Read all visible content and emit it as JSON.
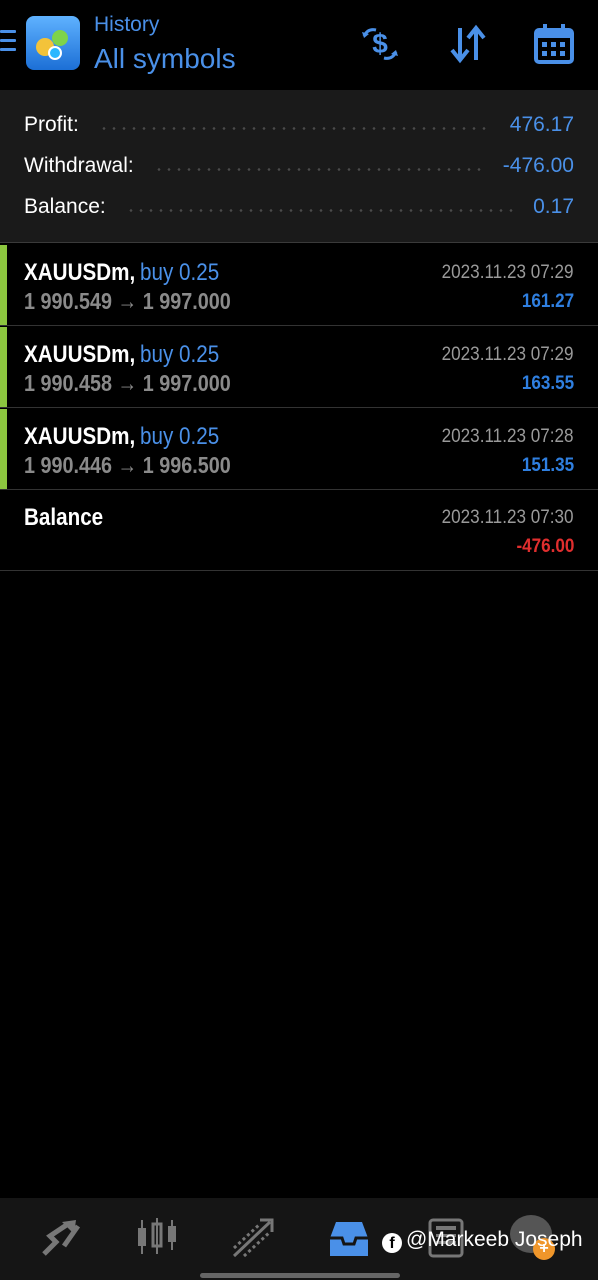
{
  "header": {
    "title_small": "History",
    "title_big": "All symbols",
    "icons": [
      "menu-icon",
      "app-logo",
      "deposit-withdrawal-icon",
      "sort-icon",
      "calendar-icon"
    ],
    "accent_color": "#4a90e8"
  },
  "summary": {
    "profit_label": "Profit:",
    "profit_value": "476.17",
    "withdrawal_label": "Withdrawal:",
    "withdrawal_value": "-476.00",
    "balance_label": "Balance:",
    "balance_value": "0.17"
  },
  "trades": [
    {
      "symbol": "XAUUSDm,",
      "type": "buy 0.25",
      "prices": "1 990.549 → 1 997.000",
      "time": "2023.11.23 07:29",
      "profit": "161.27"
    },
    {
      "symbol": "XAUUSDm,",
      "type": "buy 0.25",
      "prices": "1 990.458 → 1 997.000",
      "time": "2023.11.23 07:29",
      "profit": "163.55"
    },
    {
      "symbol": "XAUUSDm,",
      "type": "buy 0.25",
      "prices": "1 990.446 → 1 996.500",
      "time": "2023.11.23 07:28",
      "profit": "151.35"
    }
  ],
  "balance_op": {
    "label": "Balance",
    "time": "2023.11.23 07:30",
    "amount": "-476.00"
  },
  "colors": {
    "buy_bar": "#8cc63f",
    "positive": "#2f7fe0",
    "negative": "#e02e2e"
  },
  "bottom_nav": {
    "icons": [
      "trade-icon",
      "chart-icon",
      "trends-icon",
      "history-icon",
      "news-icon",
      "chat-icon"
    ],
    "active": "history-icon"
  },
  "watermark": {
    "fb_glyph": "f",
    "text": "@Markeeb Joseph"
  },
  "chat_badge": "+"
}
